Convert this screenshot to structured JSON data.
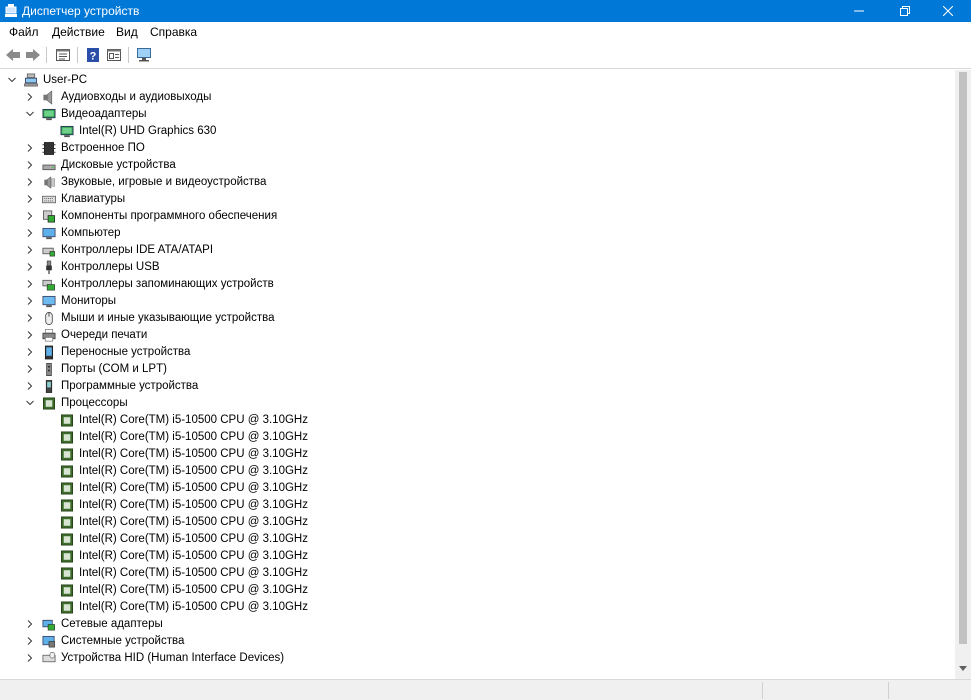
{
  "window": {
    "title": "Диспетчер устройств",
    "icon": "device-manager-icon"
  },
  "menu": [
    {
      "label": "Файл"
    },
    {
      "label": "Действие"
    },
    {
      "label": "Вид"
    },
    {
      "label": "Справка"
    }
  ],
  "toolbar": {
    "buttons": [
      "back-arrow-icon",
      "forward-arrow-icon",
      "properties-icon",
      "help-icon",
      "view-icon",
      "monitor-scan-icon"
    ]
  },
  "tree": {
    "root": "User-PC",
    "categories": [
      {
        "label": "Аудиовходы и аудиовыходы",
        "icon": "speaker-icon",
        "expanded": false
      },
      {
        "label": "Видеоадаптеры",
        "icon": "display-adapter-icon",
        "expanded": true,
        "children": [
          "Intel(R) UHD Graphics 630"
        ]
      },
      {
        "label": "Встроенное ПО",
        "icon": "firmware-icon",
        "expanded": false
      },
      {
        "label": "Дисковые устройства",
        "icon": "disk-drive-icon",
        "expanded": false
      },
      {
        "label": "Звуковые, игровые и видеоустройства",
        "icon": "sound-icon",
        "expanded": false
      },
      {
        "label": "Клавиатуры",
        "icon": "keyboard-icon",
        "expanded": false
      },
      {
        "label": "Компоненты программного обеспечения",
        "icon": "software-component-icon",
        "expanded": false
      },
      {
        "label": "Компьютер",
        "icon": "computer-icon",
        "expanded": false
      },
      {
        "label": "Контроллеры IDE ATA/ATAPI",
        "icon": "ide-controller-icon",
        "expanded": false
      },
      {
        "label": "Контроллеры USB",
        "icon": "usb-icon",
        "expanded": false
      },
      {
        "label": "Контроллеры запоминающих устройств",
        "icon": "storage-controller-icon",
        "expanded": false
      },
      {
        "label": "Мониторы",
        "icon": "monitor-icon",
        "expanded": false
      },
      {
        "label": "Мыши и иные указывающие устройства",
        "icon": "mouse-icon",
        "expanded": false
      },
      {
        "label": "Очереди печати",
        "icon": "printer-icon",
        "expanded": false
      },
      {
        "label": "Переносные устройства",
        "icon": "portable-device-icon",
        "expanded": false
      },
      {
        "label": "Порты (COM и LPT)",
        "icon": "port-icon",
        "expanded": false
      },
      {
        "label": "Программные устройства",
        "icon": "software-device-icon",
        "expanded": false
      },
      {
        "label": "Процессоры",
        "icon": "processor-icon",
        "expanded": true,
        "children": [
          "Intel(R) Core(TM) i5-10500 CPU @ 3.10GHz",
          "Intel(R) Core(TM) i5-10500 CPU @ 3.10GHz",
          "Intel(R) Core(TM) i5-10500 CPU @ 3.10GHz",
          "Intel(R) Core(TM) i5-10500 CPU @ 3.10GHz",
          "Intel(R) Core(TM) i5-10500 CPU @ 3.10GHz",
          "Intel(R) Core(TM) i5-10500 CPU @ 3.10GHz",
          "Intel(R) Core(TM) i5-10500 CPU @ 3.10GHz",
          "Intel(R) Core(TM) i5-10500 CPU @ 3.10GHz",
          "Intel(R) Core(TM) i5-10500 CPU @ 3.10GHz",
          "Intel(R) Core(TM) i5-10500 CPU @ 3.10GHz",
          "Intel(R) Core(TM) i5-10500 CPU @ 3.10GHz",
          "Intel(R) Core(TM) i5-10500 CPU @ 3.10GHz"
        ]
      },
      {
        "label": "Сетевые адаптеры",
        "icon": "network-adapter-icon",
        "expanded": false
      },
      {
        "label": "Системные устройства",
        "icon": "system-device-icon",
        "expanded": false
      },
      {
        "label": "Устройства HID (Human Interface Devices)",
        "icon": "hid-icon",
        "expanded": false
      }
    ]
  },
  "colors": {
    "titlebar": "#0078d7",
    "selection": "#cce8ff"
  }
}
